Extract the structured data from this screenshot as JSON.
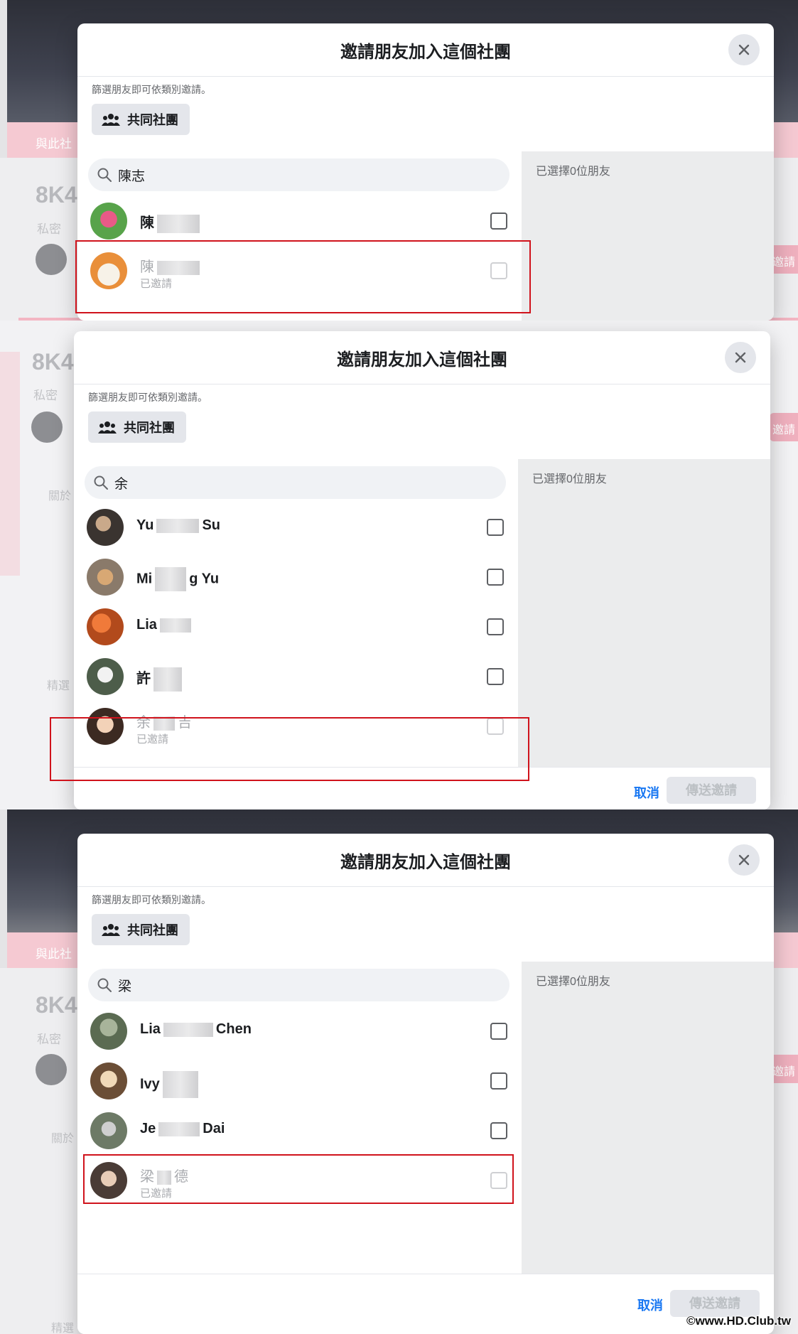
{
  "panels": [
    {
      "modal_title": "邀請朋友加入這個社團",
      "hint": "篩選朋友即可依類別邀請。",
      "filter_chip": "共同社團",
      "search_value": "陳志",
      "selected_label": "已選擇0位朋友",
      "friends": [
        {
          "name_start": "陳",
          "name_end": "",
          "status": "",
          "invited": false
        },
        {
          "name_start": "陳",
          "name_end": "",
          "status": "已邀請",
          "invited": true
        }
      ]
    },
    {
      "modal_title": "邀請朋友加入這個社團",
      "hint": "篩選朋友即可依類別邀請。",
      "filter_chip": "共同社團",
      "search_value": "余",
      "selected_label": "已選擇0位朋友",
      "friends": [
        {
          "name_start": "Yu",
          "name_end": "Su",
          "status": "",
          "invited": false
        },
        {
          "name_start": "Mi",
          "name_end": "g Yu",
          "status": "",
          "invited": false
        },
        {
          "name_start": "Lia",
          "name_end": "",
          "status": "",
          "invited": false
        },
        {
          "name_start": "許",
          "name_end": "",
          "status": "",
          "invited": false
        },
        {
          "name_start": "余",
          "name_end": "吉",
          "status": "已邀請",
          "invited": true
        }
      ],
      "cancel_label": "取消",
      "send_label": "傳送邀請"
    },
    {
      "modal_title": "邀請朋友加入這個社團",
      "hint": "篩選朋友即可依類別邀請。",
      "filter_chip": "共同社團",
      "search_value": "梁",
      "selected_label": "已選擇0位朋友",
      "friends": [
        {
          "name_start": "Lia",
          "name_end": "Chen",
          "status": "",
          "invited": false
        },
        {
          "name_start": "Ivy",
          "name_end": "",
          "status": "",
          "invited": false
        },
        {
          "name_start": "Je",
          "name_end": "Dai",
          "status": "",
          "invited": false
        },
        {
          "name_start": "梁",
          "name_end": "德",
          "status": "已邀請",
          "invited": true
        }
      ],
      "cancel_label": "取消",
      "send_label": "傳送邀請"
    }
  ],
  "background": {
    "group_title": "8K4",
    "privacy": "私密",
    "strip_text": "與此社",
    "about_tab": "關於",
    "featured": "精選",
    "invite_btn": "邀請"
  },
  "watermark": "©www.HD.Club.tw",
  "colors": {
    "highlight": "#d0131c",
    "link": "#1877f2",
    "accent_pink": "#f5c9d2"
  }
}
